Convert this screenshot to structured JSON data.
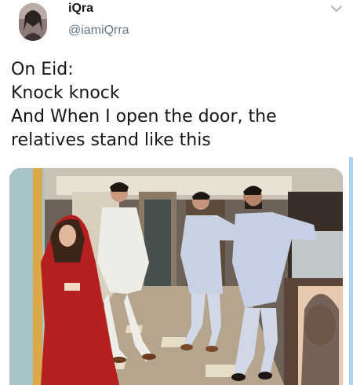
{
  "author": {
    "name": "iQra",
    "handle": "@iamiQrra",
    "avatar_icon": "profile-avatar"
  },
  "menu_icon": "chevron-down-icon",
  "tweet": {
    "lines": [
      "On Eid:",
      "Knock knock",
      "And When I open the door, the",
      "relatives stand like this"
    ]
  },
  "media": {
    "kind": "photo",
    "subject": "four people posing in a hallway"
  },
  "colors": {
    "text_primary": "#14171a",
    "text_secondary": "#657786",
    "icon_gray": "#aab8c2",
    "accent_edge": "#a8d6f0"
  }
}
